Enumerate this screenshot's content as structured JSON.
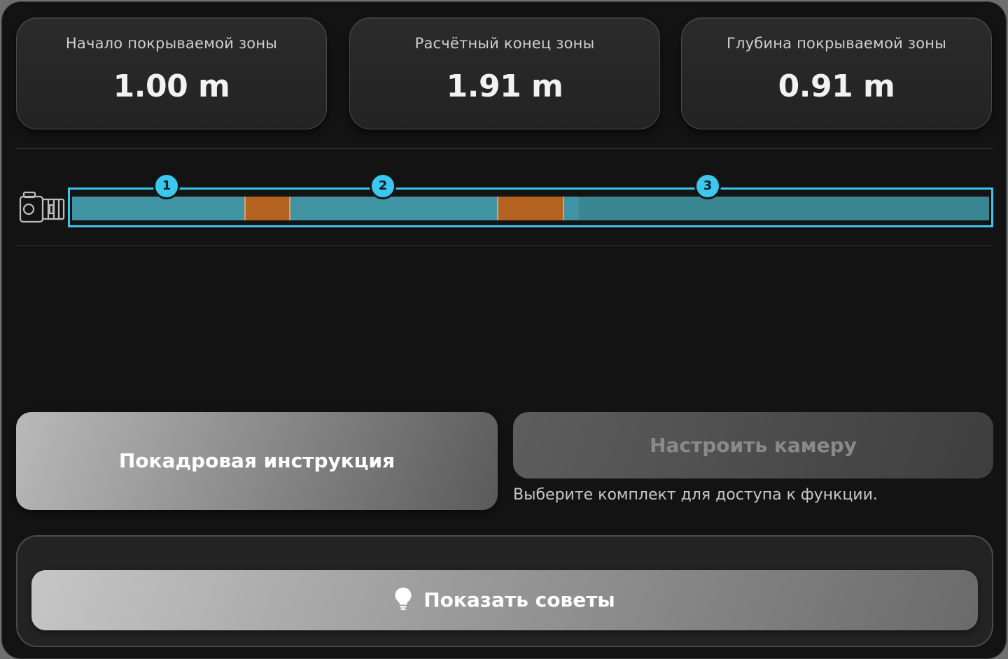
{
  "stats": [
    {
      "label": "Начало покрываемой зоны",
      "value": "1.00 m"
    },
    {
      "label": "Расчётный конец зоны",
      "value": "1.91 m"
    },
    {
      "label": "Глубина покрываемой зоны",
      "value": "0.91 m"
    }
  ],
  "coverage_bar": {
    "markers": [
      "1",
      "2",
      "3"
    ],
    "accent_color": "#39c6ea",
    "zone_color": "#3f93a3",
    "gap_color": "#b3621f",
    "camera_icon": "camera-icon"
  },
  "actions": {
    "frame_instruction_label": "Покадровая инструкция",
    "configure_camera_label": "Настроить камеру",
    "configure_camera_hint": "Выберите комплект для доступа к функции."
  },
  "tips": {
    "show_tips_label": "Показать советы",
    "icon": "lightbulb-icon"
  }
}
